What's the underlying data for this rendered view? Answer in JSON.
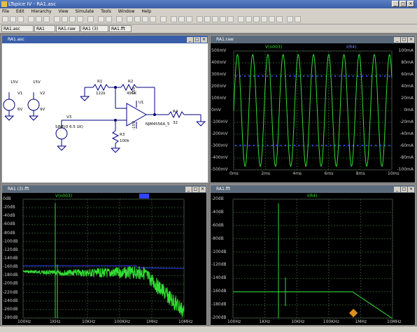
{
  "window": {
    "title": "LTspice IV - RA1.asc"
  },
  "menu": [
    "File",
    "Edit",
    "Hierarchy",
    "View",
    "Simulate",
    "Tools",
    "Window",
    "Help"
  ],
  "tabs": [
    "RA1.asc",
    "RA1",
    "RA1.raw",
    "RA1 (3)",
    "RA1.fft"
  ],
  "schematic": {
    "title": "RA1.asc",
    "labels": {
      "v1_volt": "15V",
      "v1_name": "V1",
      "v1_b": "6V",
      "v2_volt": "15V",
      "v2_name": "V2",
      "v2_b": "9V",
      "v3_name": "V3",
      "v3_src": "SINE(0 6.5 1K)",
      "r1_name": "R1",
      "r1_val": "122k",
      "r2_name": "R2",
      "r2_val": "495K",
      "r3_name": "R3",
      "r3_val": "100k",
      "r4_name": "R4",
      "r4_val": "32",
      "u1_name": "U1",
      "u1_model": "NJM4556A_5",
      "u1_vp": "15V",
      "u1_vn": "-15V"
    }
  },
  "transient": {
    "title": "RA1.raw",
    "trace_left": "V(n003)",
    "trace_right": "I(R4)",
    "y_left": [
      "500mV",
      "400mV",
      "300mV",
      "200mV",
      "100mV",
      "0mV",
      "-100mV",
      "-200mV",
      "-300mV",
      "-400mV",
      "-500mV"
    ],
    "y_right": [
      "100mA",
      "80mA",
      "60mA",
      "40mA",
      "20mA",
      "0mA",
      "-20mA",
      "-40mA",
      "-60mA",
      "-80mA",
      "-100mA"
    ],
    "x_ticks": [
      "0ms",
      "2ms",
      "4ms",
      "6ms",
      "8ms",
      "10ms"
    ]
  },
  "fft_left": {
    "title": "RA1 (3).fft",
    "trace": "V(n003)",
    "y_ticks": [
      "0dB",
      "-20dB",
      "-40dB",
      "-60dB",
      "-80dB",
      "-100dB",
      "-120dB",
      "-140dB",
      "-160dB",
      "-180dB",
      "-200dB",
      "-220dB",
      "-240dB",
      "-260dB",
      "-280dB"
    ],
    "x_ticks": [
      "100Hz",
      "1KHz",
      "10KHz",
      "100KHz",
      "1MHz",
      "10MHz"
    ]
  },
  "fft_right": {
    "title": "RA1.fft",
    "trace": "I(R4)",
    "y_ticks": [
      "-20dB",
      "-40dB",
      "-60dB",
      "-80dB",
      "-100dB",
      "-120dB",
      "-140dB",
      "-160dB",
      "-180dB",
      "-200dB"
    ],
    "x_ticks": [
      "100Hz",
      "1KHz",
      "10KHz",
      "100KHz",
      "1MHz",
      "10MHz"
    ]
  },
  "colors": {
    "trace_green": "#33dd33",
    "trace_blue": "#3344ff",
    "wire": "#000080",
    "grid": "#2a4a2a"
  }
}
